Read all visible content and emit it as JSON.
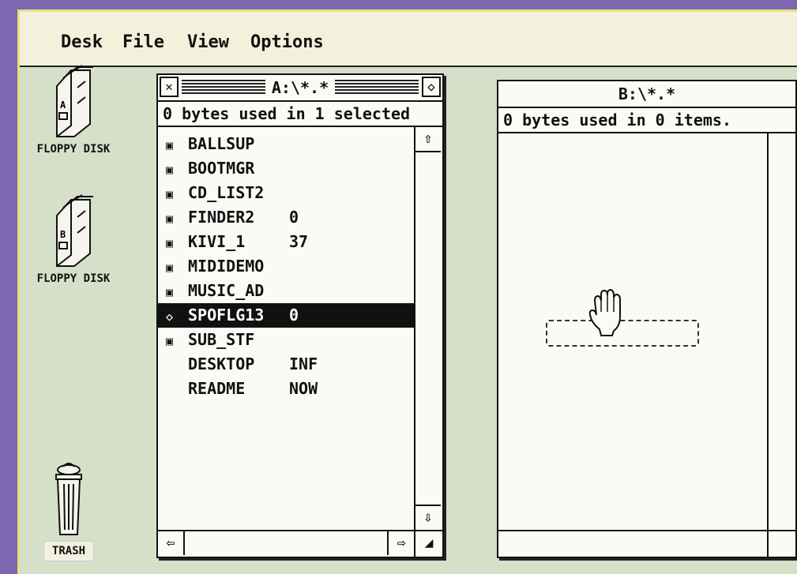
{
  "menubar": {
    "items": [
      "Desk",
      "File",
      "View",
      "Options"
    ]
  },
  "desktop": {
    "icons": {
      "floppy_a": "FLOPPY DISK",
      "floppy_b": "FLOPPY DISK",
      "trash": "TRASH"
    }
  },
  "window_a": {
    "title": "A:\\*.*",
    "info": "0 bytes used in 1 selected",
    "files": [
      {
        "name": "BALLSUP",
        "ext": ""
      },
      {
        "name": "BOOTMGR",
        "ext": ""
      },
      {
        "name": "CD_LIST2",
        "ext": ""
      },
      {
        "name": "FINDER2",
        "ext": "0"
      },
      {
        "name": "KIVI_1",
        "ext": "37"
      },
      {
        "name": "MIDIDEMO",
        "ext": ""
      },
      {
        "name": "MUSIC_AD",
        "ext": ""
      },
      {
        "name": "SPOFLG13",
        "ext": "0"
      },
      {
        "name": "SUB_STF",
        "ext": ""
      },
      {
        "name": "DESKTOP",
        "ext": "INF"
      },
      {
        "name": "README",
        "ext": "NOW"
      }
    ]
  },
  "window_b": {
    "title": "B:\\*.*",
    "info": "0 bytes used in 0 items."
  },
  "colors": {
    "border": "#7e66b0",
    "desktop": "#d6e0c9",
    "window": "#fbfbf6"
  }
}
